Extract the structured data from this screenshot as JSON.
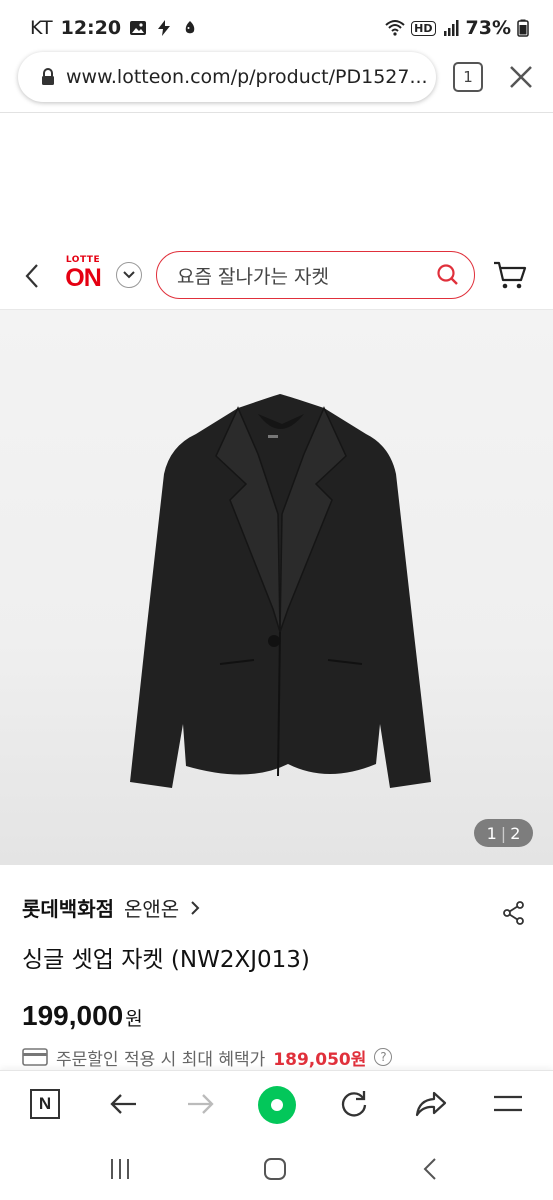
{
  "status_bar": {
    "carrier": "KT",
    "time": "12:20",
    "hd_label": "HD",
    "battery": "73%"
  },
  "browser": {
    "url": "www.lotteon.com/p/product/PD1527...",
    "tab_count": "1"
  },
  "site_header": {
    "logo_top": "LOTTE",
    "logo_main": "ON",
    "search_placeholder": "요즘 잘나가는 자켓"
  },
  "product": {
    "image_counter": {
      "current": "1",
      "total": "2"
    },
    "store": "롯데백화점",
    "brand": "온앤온",
    "title": "싱글 셋업 자켓 (NW2XJ013)",
    "price": "199,000",
    "price_unit": "원",
    "benefit_label": "주문할인 적용 시 최대 혜택가",
    "benefit_price": "189,050원",
    "help_label": "?"
  },
  "colors": {
    "brand_red": "#e50012",
    "search_border": "#e0303b",
    "naver_green": "#03c75a"
  },
  "toolbar": {
    "n_label": "N"
  }
}
